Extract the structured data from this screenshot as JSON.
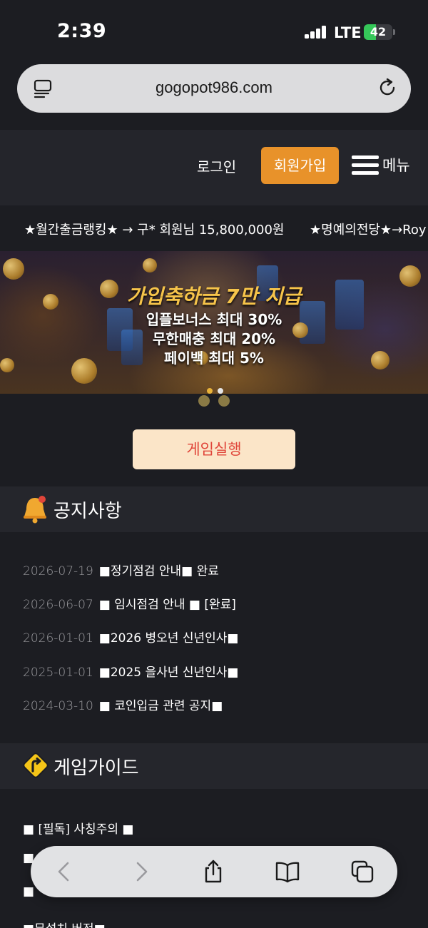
{
  "status_bar": {
    "time": "2:39",
    "network": "LTE",
    "battery": "42",
    "battery_level": 0.42
  },
  "address_bar": {
    "url": "gogopot986.com",
    "icons": [
      "reader-icon",
      "reload-icon"
    ]
  },
  "header": {
    "login_label": "로그인",
    "signup_label": "회원가입",
    "menu_label": "메뉴",
    "colors": {
      "signup_bg": "#e8922a",
      "header_bg": "#24252b"
    }
  },
  "ticker": {
    "items": [
      "★월간출금랭킹★ → 구* 회원님 15,800,000원",
      "★명예의전당★→Roy"
    ]
  },
  "banner": {
    "title": "가입축하금 7만 지급",
    "lines": [
      "입플보너스 최대 30%",
      "무한매충 최대 20%",
      "페이백 최대 5%"
    ],
    "colors": {
      "title": "#f6c44a"
    }
  },
  "play_button": {
    "label": "게임실행",
    "colors": {
      "bg": "#fbe5c8",
      "text": "#e0453a"
    }
  },
  "notices": {
    "title": "공지사항",
    "icon": "bell-icon",
    "items": [
      {
        "date": "2026-07-19",
        "title": "■정기점검 안내■ 완료"
      },
      {
        "date": "2026-06-07",
        "title": "■ 임시점검 안내 ■ [완료]"
      },
      {
        "date": "2026-01-01",
        "title": "■2026 병오년 신년인사■"
      },
      {
        "date": "2025-01-01",
        "title": "■2025 을사년 신년인사■"
      },
      {
        "date": "2024-03-10",
        "title": "■ 코인입금 관련 공지■"
      }
    ]
  },
  "guide": {
    "title": "게임가이드",
    "icon": "road-sign-icon",
    "items": [
      "■ [필독] 사칭주의 ■",
      "■",
      "■",
      "■무설치 버전■"
    ]
  },
  "toolbar": {
    "icons": [
      "back-icon",
      "forward-icon",
      "share-icon",
      "bookmarks-icon",
      "tabs-icon"
    ]
  }
}
